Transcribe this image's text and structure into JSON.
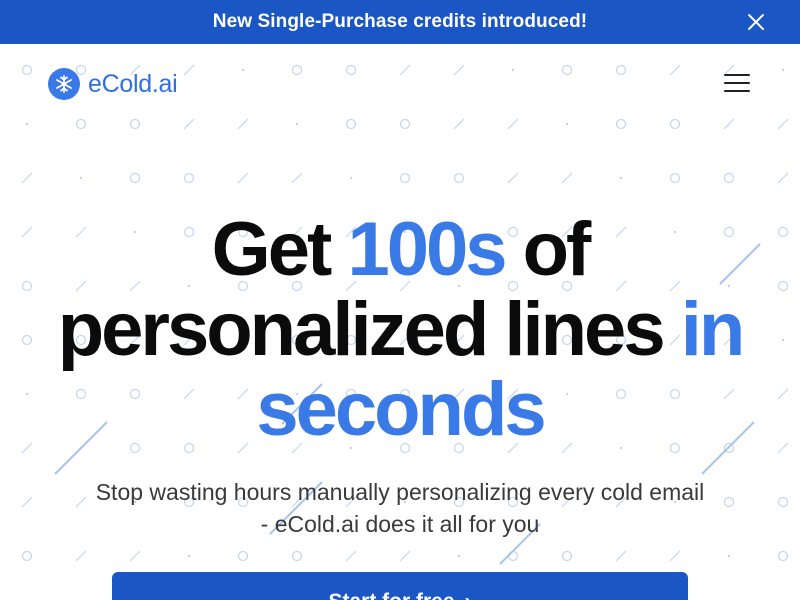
{
  "banner": {
    "text": "New Single-Purchase credits introduced!",
    "close_icon": "close-icon",
    "color": "#1a56c4"
  },
  "nav": {
    "logo_text": "eCold.ai",
    "logo_icon": "snowflake-icon",
    "menu_icon": "hamburger-menu-icon"
  },
  "hero": {
    "line1_a": "Get ",
    "line1_b": "100s",
    "line1_c": " of",
    "line2_a": "personalized lines ",
    "line2_b": "in",
    "line3": "seconds",
    "subtitle_line1": "Stop wasting hours manually personalizing every cold email",
    "subtitle_line2": "- eCold.ai does it all for you",
    "accent_color": "#3a7ae6"
  },
  "cta": {
    "label": "Start for free",
    "arrow": "›"
  }
}
